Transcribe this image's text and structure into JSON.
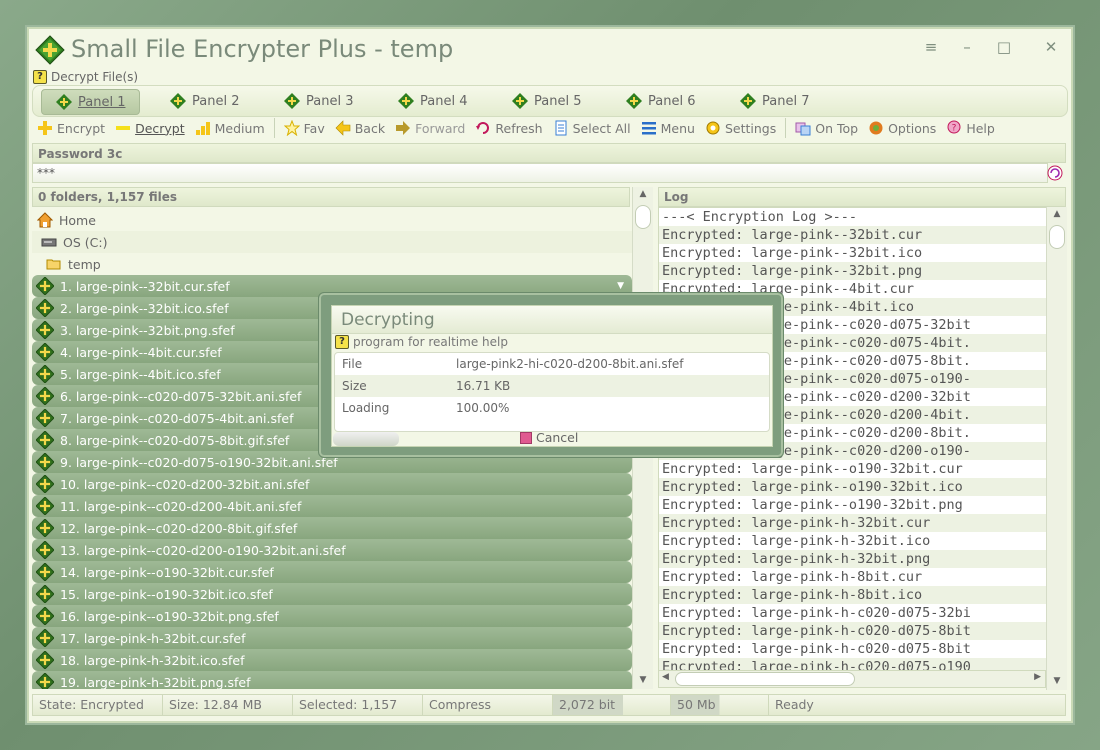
{
  "window": {
    "title": "Small File Encrypter Plus - temp"
  },
  "help_line": "Decrypt File(s)",
  "window_controls": {
    "menu": "≡",
    "minimize": "–",
    "maximize": "□",
    "close": "✕"
  },
  "tabs": [
    "Panel 1",
    "Panel 2",
    "Panel 3",
    "Panel 4",
    "Panel 5",
    "Panel 6",
    "Panel 7"
  ],
  "toolbar": {
    "encrypt": "Encrypt",
    "decrypt": "Decrypt",
    "medium": "Medium",
    "fav": "Fav",
    "back": "Back",
    "forward": "Forward",
    "refresh": "Refresh",
    "select_all": "Select All",
    "menu": "Menu",
    "settings": "Settings",
    "on_top": "On Top",
    "options": "Options",
    "help": "Help"
  },
  "password": {
    "label": "Password 3c",
    "value": "***"
  },
  "file_panel": {
    "header": "0 folders, 1,157 files",
    "nav": [
      "Home",
      "OS (C:)",
      "temp"
    ],
    "files": [
      "1. large-pink--32bit.cur.sfef",
      "2. large-pink--32bit.ico.sfef",
      "3. large-pink--32bit.png.sfef",
      "4. large-pink--4bit.cur.sfef",
      "5. large-pink--4bit.ico.sfef",
      "6. large-pink--c020-d075-32bit.ani.sfef",
      "7. large-pink--c020-d075-4bit.ani.sfef",
      "8. large-pink--c020-d075-8bit.gif.sfef",
      "9. large-pink--c020-d075-o190-32bit.ani.sfef",
      "10. large-pink--c020-d200-32bit.ani.sfef",
      "11. large-pink--c020-d200-4bit.ani.sfef",
      "12. large-pink--c020-d200-8bit.gif.sfef",
      "13. large-pink--c020-d200-o190-32bit.ani.sfef",
      "14. large-pink--o190-32bit.cur.sfef",
      "15. large-pink--o190-32bit.ico.sfef",
      "16. large-pink--o190-32bit.png.sfef",
      "17. large-pink-h-32bit.cur.sfef",
      "18. large-pink-h-32bit.ico.sfef",
      "19. large-pink-h-32bit.png.sfef"
    ]
  },
  "log_panel": {
    "header": "Log",
    "lines": [
      "---< Encryption Log >---",
      "Encrypted: large-pink--32bit.cur",
      "Encrypted: large-pink--32bit.ico",
      "Encrypted: large-pink--32bit.png",
      "Encrypted: large-pink--4bit.cur",
      "Encrypted: large-pink--4bit.ico",
      "Encrypted: large-pink--c020-d075-32bit",
      "Encrypted: large-pink--c020-d075-4bit.",
      "Encrypted: large-pink--c020-d075-8bit.",
      "Encrypted: large-pink--c020-d075-o190-",
      "Encrypted: large-pink--c020-d200-32bit",
      "Encrypted: large-pink--c020-d200-4bit.",
      "Encrypted: large-pink--c020-d200-8bit.",
      "Encrypted: large-pink--c020-d200-o190-",
      "Encrypted: large-pink--o190-32bit.cur",
      "Encrypted: large-pink--o190-32bit.ico",
      "Encrypted: large-pink--o190-32bit.png",
      "Encrypted: large-pink-h-32bit.cur",
      "Encrypted: large-pink-h-32bit.ico",
      "Encrypted: large-pink-h-32bit.png",
      "Encrypted: large-pink-h-8bit.cur",
      "Encrypted: large-pink-h-8bit.ico",
      "Encrypted: large-pink-h-c020-d075-32bi",
      "Encrypted: large-pink-h-c020-d075-8bit",
      "Encrypted: large-pink-h-c020-d075-8bit",
      "Encrypted: large-pink-h-c020-d075-o190"
    ]
  },
  "status": {
    "state": "State: Encrypted",
    "size": "Size: 12.84 MB",
    "selected": "Selected: 1,157",
    "compress": "Compress",
    "bits": "2,072 bit",
    "mem": "50 Mb",
    "ready": "Ready"
  },
  "dialog": {
    "title": "Decrypting",
    "help": "program for realtime help",
    "rows": [
      {
        "key": "File",
        "value": "large-pink2-hi-c020-d200-8bit.ani.sfef"
      },
      {
        "key": "Size",
        "value": "16.71 KB"
      },
      {
        "key": "Loading",
        "value": "100.00%"
      }
    ],
    "progress_fraction": 0.15,
    "cancel": "Cancel"
  },
  "colors": {
    "accent_green": "#2e7d1e",
    "file_row": "#93b08a",
    "background": "#f3f7e6"
  }
}
